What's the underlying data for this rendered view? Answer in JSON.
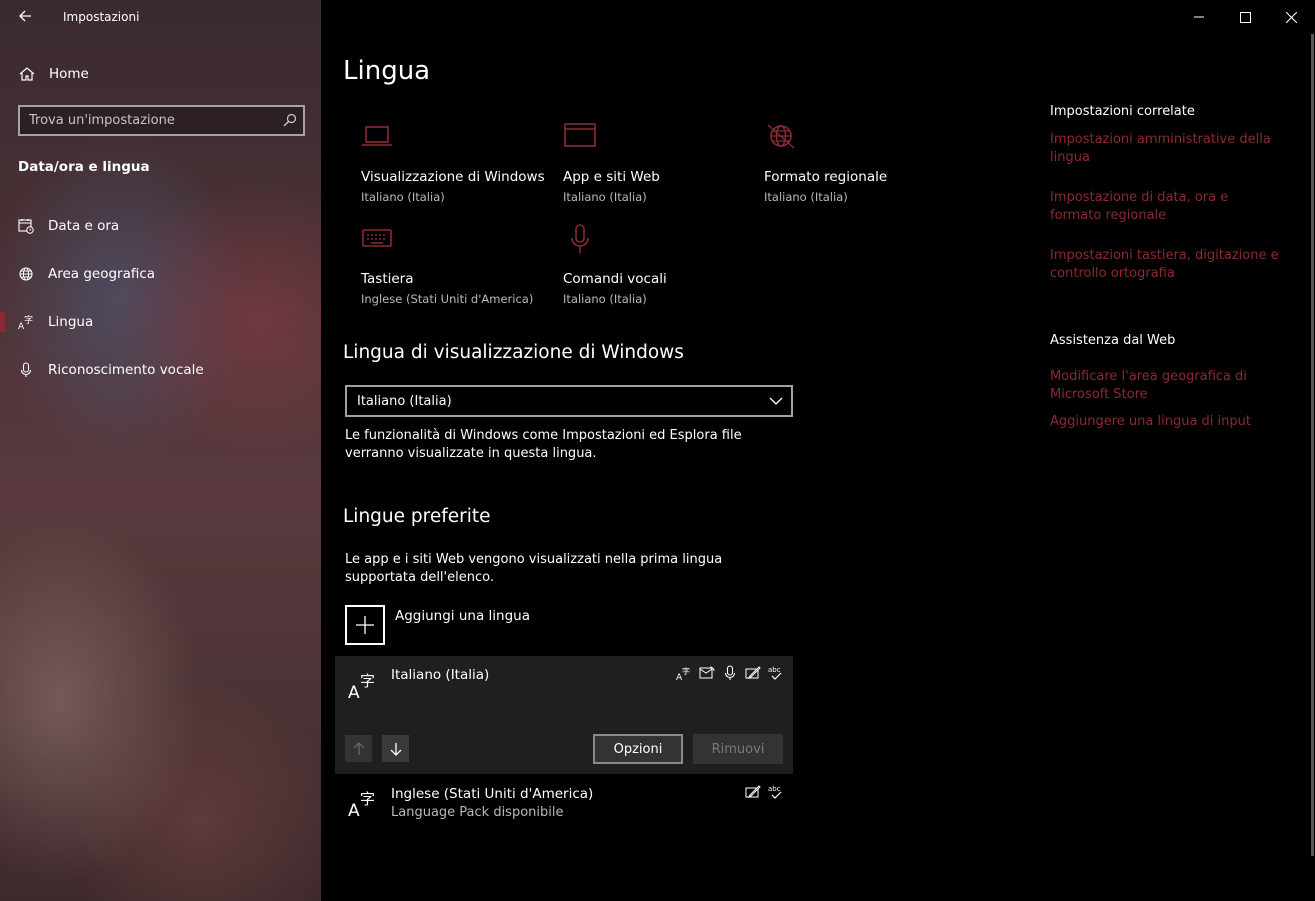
{
  "app": {
    "title": "Impostazioni"
  },
  "sidebar": {
    "home_label": "Home",
    "search_placeholder": "Trova un'impostazione",
    "section_label": "Data/ora e lingua",
    "items": [
      {
        "label": "Data e ora",
        "icon": "calendar-clock-icon"
      },
      {
        "label": "Area geografica",
        "icon": "globe-icon"
      },
      {
        "label": "Lingua",
        "icon": "language-icon",
        "active": true
      },
      {
        "label": "Riconoscimento vocale",
        "icon": "microphone-icon"
      }
    ]
  },
  "main": {
    "title": "Lingua",
    "tiles": [
      {
        "name": "Visualizzazione di Windows",
        "value": "Italiano (Italia)",
        "icon": "laptop-icon"
      },
      {
        "name": "App e siti Web",
        "value": "Italiano (Italia)",
        "icon": "browser-window-icon"
      },
      {
        "name": "Formato regionale",
        "value": "Italiano (Italia)",
        "icon": "globe-format-icon"
      },
      {
        "name": "Tastiera",
        "value": "Inglese (Stati Uniti d'America)",
        "icon": "keyboard-icon"
      },
      {
        "name": "Comandi vocali",
        "value": "Italiano (Italia)",
        "icon": "microphone-icon"
      }
    ],
    "display_language": {
      "heading": "Lingua di visualizzazione di Windows",
      "selected": "Italiano (Italia)",
      "description": "Le funzionalità di Windows come Impostazioni ed Esplora file verranno visualizzate in questa lingua."
    },
    "preferred": {
      "heading": "Lingue preferite",
      "description": "Le app e i siti Web vengono visualizzati nella prima lingua supportata dell'elenco.",
      "add_label": "Aggiungi una lingua",
      "languages": [
        {
          "name": "Italiano (Italia)",
          "sub": "",
          "features": [
            "display-language-icon",
            "text-to-speech-icon",
            "speech-icon",
            "handwriting-icon",
            "spellcheck-icon"
          ]
        },
        {
          "name": "Inglese (Stati Uniti d'America)",
          "sub": "Language Pack disponibile",
          "features": [
            "handwriting-icon",
            "spellcheck-icon"
          ]
        }
      ],
      "options_label": "Opzioni",
      "remove_label": "Rimuovi"
    }
  },
  "related": {
    "heading": "Impostazioni correlate",
    "links": [
      "Impostazioni amministrative della lingua",
      "Impostazione di data, ora e formato regionale",
      "Impostazioni tastiera, digitazione e controllo ortografia"
    ],
    "help_heading": "Assistenza dal Web",
    "help_links": [
      "Modificare l'area geografica di Microsoft Store",
      "Aggiungere una lingua di input"
    ]
  },
  "colors": {
    "accent": "#8a2a32",
    "background": "#000000",
    "selected_card": "#1f1f1f"
  }
}
